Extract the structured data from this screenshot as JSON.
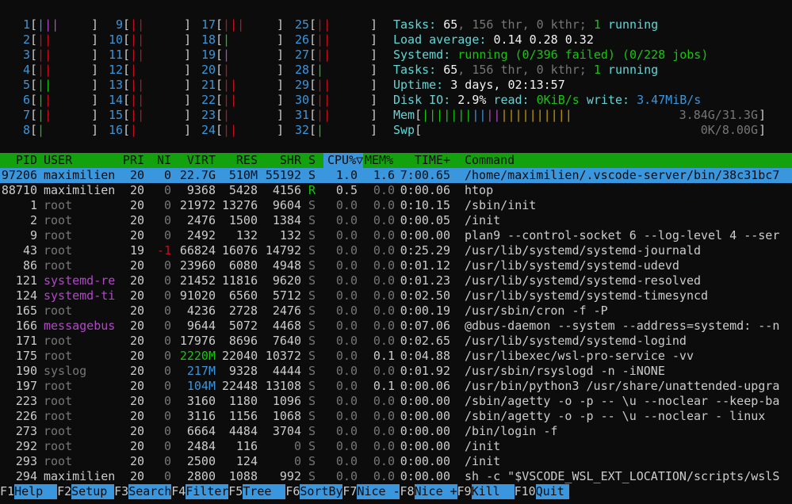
{
  "cpus": [
    {
      "id": "1",
      "bars": [
        [
          "c",
          "|"
        ],
        [
          "m",
          "|"
        ],
        [
          "m",
          "|"
        ]
      ]
    },
    {
      "id": "2",
      "bars": [
        [
          "r",
          "|"
        ],
        [
          "r",
          "|"
        ]
      ]
    },
    {
      "id": "3",
      "bars": [
        [
          "r",
          "|"
        ],
        [
          "r",
          "|"
        ]
      ]
    },
    {
      "id": "4",
      "bars": [
        [
          "r",
          "|"
        ],
        [
          "r",
          "|"
        ]
      ]
    },
    {
      "id": "5",
      "bars": [
        [
          "g",
          "|"
        ],
        [
          "g",
          "|"
        ]
      ]
    },
    {
      "id": "6",
      "bars": [
        [
          "g",
          "|"
        ],
        [
          "r",
          "|"
        ]
      ]
    },
    {
      "id": "7",
      "bars": [
        [
          "g",
          "|"
        ],
        [
          "r",
          "|"
        ]
      ]
    },
    {
      "id": "8",
      "bars": [
        [
          "g",
          "|"
        ]
      ]
    },
    {
      "id": "9",
      "bars": [
        [
          "r",
          "|"
        ],
        [
          "r",
          "|"
        ]
      ]
    },
    {
      "id": "10",
      "bars": [
        [
          "r",
          "|"
        ],
        [
          "r",
          "|"
        ]
      ]
    },
    {
      "id": "11",
      "bars": [
        [
          "r",
          "|"
        ],
        [
          "r",
          "|"
        ]
      ]
    },
    {
      "id": "12",
      "bars": [
        [
          "r",
          "|"
        ]
      ]
    },
    {
      "id": "13",
      "bars": [
        [
          "r",
          "|"
        ],
        [
          "r",
          "|"
        ]
      ]
    },
    {
      "id": "14",
      "bars": [
        [
          "r",
          "|"
        ],
        [
          "r",
          "|"
        ]
      ]
    },
    {
      "id": "15",
      "bars": [
        [
          "r",
          "|"
        ],
        [
          "r",
          "|"
        ]
      ]
    },
    {
      "id": "16",
      "bars": [
        [
          "r",
          "|"
        ]
      ]
    },
    {
      "id": "17",
      "bars": [
        [
          "r",
          "|"
        ],
        [
          "r",
          "|"
        ],
        [
          "r",
          "|"
        ]
      ]
    },
    {
      "id": "18",
      "bars": [
        [
          "g",
          "|"
        ]
      ]
    },
    {
      "id": "19",
      "bars": [
        [
          "m",
          "|"
        ]
      ]
    },
    {
      "id": "20",
      "bars": [
        [
          "r",
          "|"
        ]
      ]
    },
    {
      "id": "21",
      "bars": [
        [
          "r",
          "|"
        ],
        [
          "r",
          "|"
        ]
      ]
    },
    {
      "id": "22",
      "bars": [
        [
          "r",
          "|"
        ],
        [
          "r",
          "|"
        ]
      ]
    },
    {
      "id": "23",
      "bars": [
        [
          "r",
          "|"
        ]
      ]
    },
    {
      "id": "24",
      "bars": [
        [
          "r",
          "|"
        ],
        [
          "r",
          "|"
        ]
      ]
    },
    {
      "id": "25",
      "bars": [
        [
          "r",
          "|"
        ],
        [
          "r",
          "|"
        ]
      ]
    },
    {
      "id": "26",
      "bars": [
        [
          "r",
          "|"
        ],
        [
          "r",
          "|"
        ]
      ]
    },
    {
      "id": "27",
      "bars": [
        [
          "r",
          "|"
        ],
        [
          "r",
          "|"
        ]
      ]
    },
    {
      "id": "28",
      "bars": [
        [
          "g",
          "|"
        ]
      ]
    },
    {
      "id": "29",
      "bars": [
        [
          "r",
          "|"
        ],
        [
          "r",
          "|"
        ]
      ]
    },
    {
      "id": "30",
      "bars": [
        [
          "r",
          "|"
        ],
        [
          "r",
          "|"
        ]
      ]
    },
    {
      "id": "31",
      "bars": [
        [
          "r",
          "|"
        ],
        [
          "r",
          "|"
        ]
      ]
    },
    {
      "id": "32",
      "bars": [
        [
          "g",
          "|"
        ]
      ]
    }
  ],
  "meters": {
    "tasks1": {
      "label": "Tasks: ",
      "tasks": "65",
      "thr_sep": ", ",
      "thr": "156 thr",
      "kthr": ", 0 kthr; ",
      "running": "1",
      "running_label": " running"
    },
    "load": {
      "label": "Load average: ",
      "l1": "0.14",
      "l5": "0.28",
      "l15": "0.32"
    },
    "systemd": {
      "label": "Systemd: ",
      "state": "running",
      "failed": " (0/396 failed)",
      "jobs": " (0/228 jobs)"
    },
    "tasks2": {
      "label": "Tasks: ",
      "tasks": "65",
      "thr_sep": ", ",
      "thr": "156 thr",
      "kthr": ", 0 kthr; ",
      "running": "1",
      "running_label": " running"
    },
    "uptime": {
      "label": "Uptime: ",
      "value": "3 days, 02:13:57"
    },
    "diskio": {
      "label": "Disk IO: ",
      "pct": "2.9%",
      "read_label": " read: ",
      "read": "0KiB/s",
      "write_label": " write: ",
      "write": "3.47MiB/s"
    },
    "mem": {
      "label": "Mem",
      "value": "3.84G/31.3G"
    },
    "swp": {
      "label": "Swp",
      "value": "0K/8.00G"
    }
  },
  "table": {
    "headers": {
      "pid": "PID",
      "user": "USER",
      "pri": "PRI",
      "ni": "NI",
      "virt": "VIRT",
      "res": "RES",
      "shr": "SHR",
      "s": "S",
      "cpu": "CPU%▽",
      "mem": "MEM%",
      "time": "TIME+",
      "command": "Command"
    },
    "rows": [
      {
        "pid": "97206",
        "user": "maximilien",
        "pri": "20",
        "ni": "0",
        "virt": "22.7G",
        "res": "510M",
        "shr": "55192",
        "s": "S",
        "cpu": "1.0",
        "mem": "1.6",
        "time": "7:00.65",
        "command": "/home/maximilien/.vscode-server/bin/38c31bc7",
        "selected": true
      },
      {
        "pid": "88710",
        "user": "maximilien",
        "pri": "20",
        "ni": "0",
        "virt": "9368",
        "res": "5428",
        "shr": "4156",
        "s": "R",
        "cpu": "0.5",
        "mem": "0.0",
        "time": "0:00.06",
        "command": "htop"
      },
      {
        "pid": "1",
        "user": "root",
        "pri": "20",
        "ni": "0",
        "virt": "21972",
        "res": "13276",
        "shr": "9604",
        "s": "S",
        "cpu": "0.0",
        "mem": "0.0",
        "time": "0:10.15",
        "command": "/sbin/init"
      },
      {
        "pid": "2",
        "user": "root",
        "pri": "20",
        "ni": "0",
        "virt": "2476",
        "res": "1500",
        "shr": "1384",
        "s": "S",
        "cpu": "0.0",
        "mem": "0.0",
        "time": "0:00.05",
        "command": "/init"
      },
      {
        "pid": "9",
        "user": "root",
        "pri": "20",
        "ni": "0",
        "virt": "2492",
        "res": "132",
        "shr": "132",
        "s": "S",
        "cpu": "0.0",
        "mem": "0.0",
        "time": "0:00.00",
        "command": "plan9 --control-socket 6 --log-level 4 --ser"
      },
      {
        "pid": "43",
        "user": "root",
        "pri": "19",
        "ni": "-1",
        "virt": "66824",
        "res": "16076",
        "shr": "14792",
        "s": "S",
        "cpu": "0.0",
        "mem": "0.0",
        "time": "0:25.29",
        "command": "/usr/lib/systemd/systemd-journald"
      },
      {
        "pid": "86",
        "user": "root",
        "pri": "20",
        "ni": "0",
        "virt": "23960",
        "res": "6080",
        "shr": "4948",
        "s": "S",
        "cpu": "0.0",
        "mem": "0.0",
        "time": "0:01.12",
        "command": "/usr/lib/systemd/systemd-udevd"
      },
      {
        "pid": "121",
        "user": "systemd-re",
        "pri": "20",
        "ni": "0",
        "virt": "21452",
        "res": "11816",
        "shr": "9620",
        "s": "S",
        "cpu": "0.0",
        "mem": "0.0",
        "time": "0:01.23",
        "command": "/usr/lib/systemd/systemd-resolved"
      },
      {
        "pid": "124",
        "user": "systemd-ti",
        "pri": "20",
        "ni": "0",
        "virt": "91020",
        "res": "6560",
        "shr": "5712",
        "s": "S",
        "cpu": "0.0",
        "mem": "0.0",
        "time": "0:02.50",
        "command": "/usr/lib/systemd/systemd-timesyncd"
      },
      {
        "pid": "165",
        "user": "root",
        "pri": "20",
        "ni": "0",
        "virt": "4236",
        "res": "2728",
        "shr": "2476",
        "s": "S",
        "cpu": "0.0",
        "mem": "0.0",
        "time": "0:00.19",
        "command": "/usr/sbin/cron -f -P"
      },
      {
        "pid": "166",
        "user": "messagebus",
        "pri": "20",
        "ni": "0",
        "virt": "9644",
        "res": "5072",
        "shr": "4468",
        "s": "S",
        "cpu": "0.0",
        "mem": "0.0",
        "time": "0:07.06",
        "command": "@dbus-daemon --system --address=systemd: --n"
      },
      {
        "pid": "171",
        "user": "root",
        "pri": "20",
        "ni": "0",
        "virt": "17976",
        "res": "8696",
        "shr": "7640",
        "s": "S",
        "cpu": "0.0",
        "mem": "0.0",
        "time": "0:02.65",
        "command": "/usr/lib/systemd/systemd-logind"
      },
      {
        "pid": "175",
        "user": "root",
        "pri": "20",
        "ni": "0",
        "virt": "2220M",
        "res": "22040",
        "shr": "10372",
        "s": "S",
        "cpu": "0.0",
        "mem": "0.1",
        "time": "0:04.88",
        "command": "/usr/libexec/wsl-pro-service -vv"
      },
      {
        "pid": "190",
        "user": "syslog",
        "pri": "20",
        "ni": "0",
        "virt": "217M",
        "res": "9328",
        "shr": "4444",
        "s": "S",
        "cpu": "0.0",
        "mem": "0.0",
        "time": "0:01.92",
        "command": "/usr/sbin/rsyslogd -n -iNONE"
      },
      {
        "pid": "197",
        "user": "root",
        "pri": "20",
        "ni": "0",
        "virt": "104M",
        "res": "22448",
        "shr": "13108",
        "s": "S",
        "cpu": "0.0",
        "mem": "0.1",
        "time": "0:00.06",
        "command": "/usr/bin/python3 /usr/share/unattended-upgra"
      },
      {
        "pid": "223",
        "user": "root",
        "pri": "20",
        "ni": "0",
        "virt": "3160",
        "res": "1180",
        "shr": "1096",
        "s": "S",
        "cpu": "0.0",
        "mem": "0.0",
        "time": "0:00.00",
        "command": "/sbin/agetty -o -p -- \\u --noclear --keep-ba"
      },
      {
        "pid": "226",
        "user": "root",
        "pri": "20",
        "ni": "0",
        "virt": "3116",
        "res": "1156",
        "shr": "1068",
        "s": "S",
        "cpu": "0.0",
        "mem": "0.0",
        "time": "0:00.00",
        "command": "/sbin/agetty -o -p -- \\u --noclear - linux"
      },
      {
        "pid": "273",
        "user": "root",
        "pri": "20",
        "ni": "0",
        "virt": "6664",
        "res": "4484",
        "shr": "3704",
        "s": "S",
        "cpu": "0.0",
        "mem": "0.0",
        "time": "0:00.00",
        "command": "/bin/login -f"
      },
      {
        "pid": "292",
        "user": "root",
        "pri": "20",
        "ni": "0",
        "virt": "2484",
        "res": "116",
        "shr": "0",
        "s": "S",
        "cpu": "0.0",
        "mem": "0.0",
        "time": "0:00.00",
        "command": "/init"
      },
      {
        "pid": "293",
        "user": "root",
        "pri": "20",
        "ni": "0",
        "virt": "2500",
        "res": "124",
        "shr": "0",
        "s": "S",
        "cpu": "0.0",
        "mem": "0.0",
        "time": "0:00.00",
        "command": "/init"
      },
      {
        "pid": "294",
        "user": "maximilien",
        "pri": "20",
        "ni": "0",
        "virt": "2800",
        "res": "1088",
        "shr": "992",
        "s": "S",
        "cpu": "0.0",
        "mem": "0.0",
        "time": "0:00.00",
        "command": "sh -c \"$VSCODE_WSL_EXT_LOCATION/scripts/wslS"
      }
    ]
  },
  "footer": [
    {
      "key": "F1",
      "label": "Help"
    },
    {
      "key": "F2",
      "label": "Setup"
    },
    {
      "key": "F3",
      "label": "Search"
    },
    {
      "key": "F4",
      "label": "Filter"
    },
    {
      "key": "F5",
      "label": "Tree"
    },
    {
      "key": "F6",
      "label": "SortBy"
    },
    {
      "key": "F7",
      "label": "Nice -"
    },
    {
      "key": "F8",
      "label": "Nice +"
    },
    {
      "key": "F9",
      "label": "Kill"
    },
    {
      "key": "F10",
      "label": "Quit"
    }
  ],
  "colors": {
    "accent": "#3a96dd",
    "header_bg": "#13a10e",
    "bg": "#0c0c0c"
  }
}
